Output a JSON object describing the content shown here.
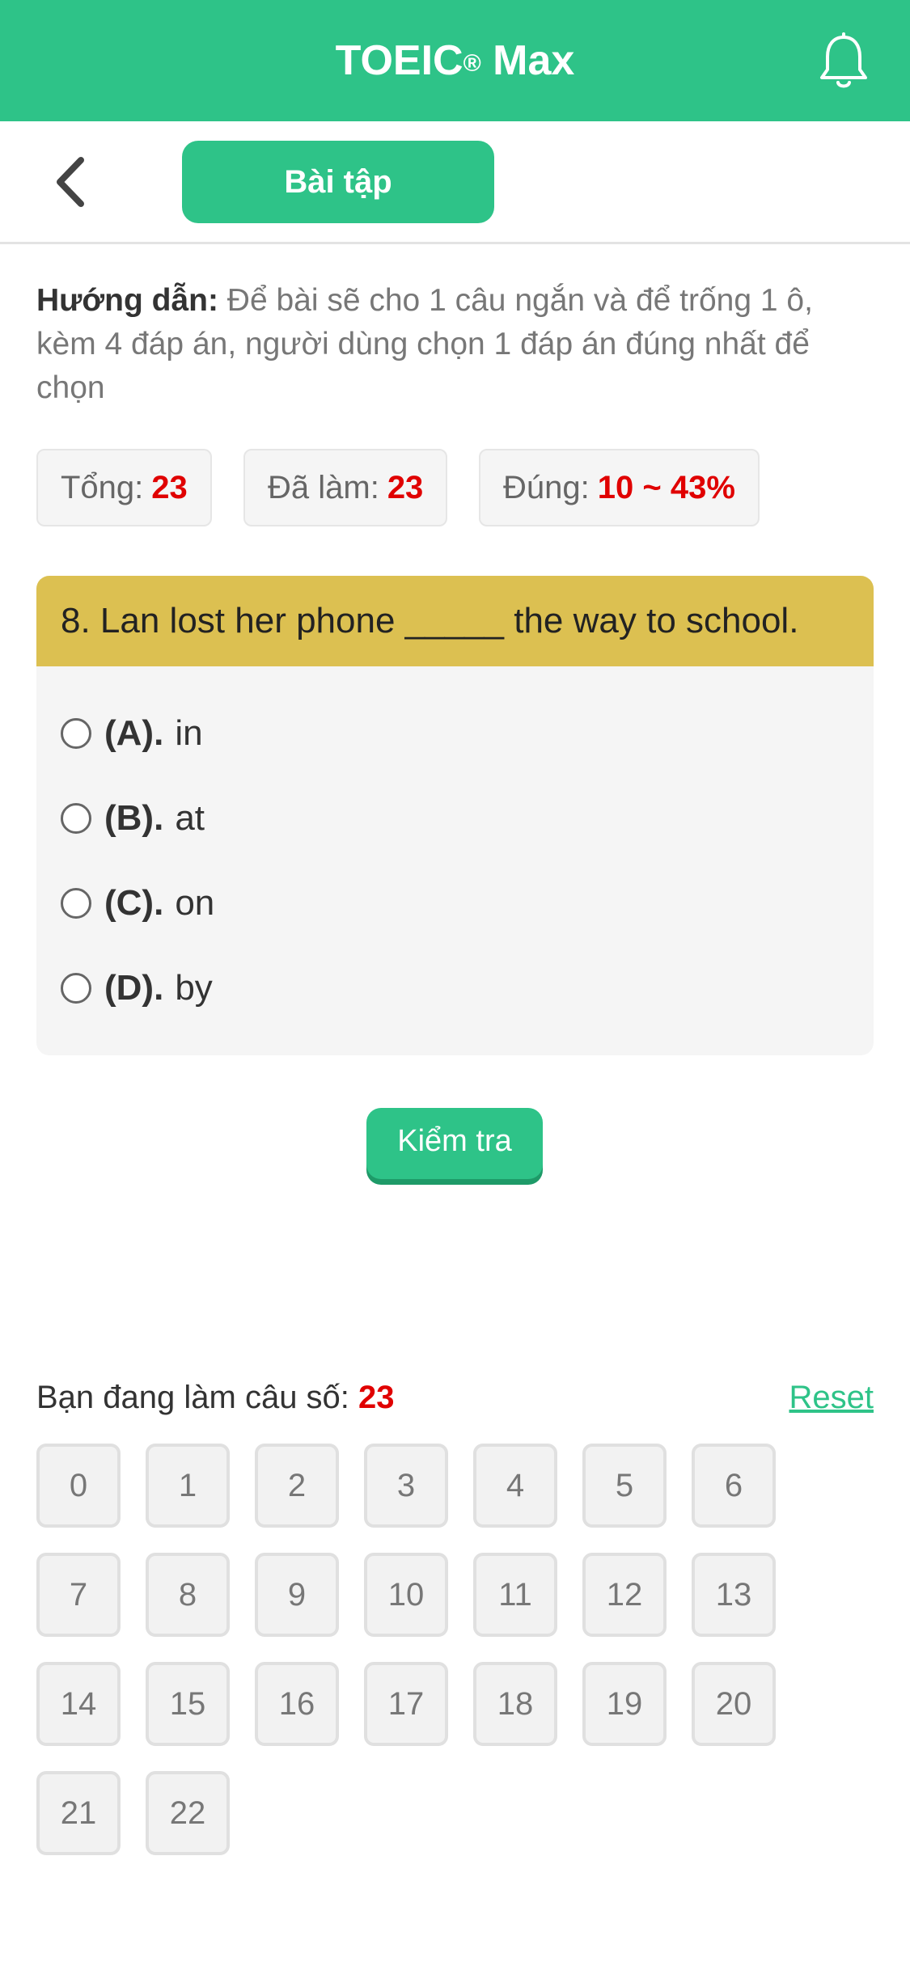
{
  "header": {
    "title_main": "TOEIC",
    "title_reg": "®",
    "title_suffix": " Max",
    "bell_icon": "bell-icon"
  },
  "subheader": {
    "back_icon": "chevron-left-icon",
    "tab_label": "Bài tập"
  },
  "guide": {
    "label": "Hướng dẫn:",
    "text": " Để bài sẽ cho 1 câu ngắn và để trống 1 ô, kèm 4 đáp án, người dùng chọn 1 đáp án đúng nhất để chọn"
  },
  "stats": {
    "total_label": "Tổng:",
    "total_value": "23",
    "done_label": "Đã làm:",
    "done_value": "23",
    "correct_label": "Đúng:",
    "correct_value": "10 ~ 43%"
  },
  "question": {
    "text": "8. Lan lost her phone _____ the way to school.",
    "options": [
      {
        "key": "(A).",
        "text": "in"
      },
      {
        "key": "(B).",
        "text": "at"
      },
      {
        "key": "(C).",
        "text": "on"
      },
      {
        "key": "(D).",
        "text": "by"
      }
    ]
  },
  "check_button": "Kiểm tra",
  "progress": {
    "label": "Bạn đang làm câu số: ",
    "value": "23",
    "reset": "Reset"
  },
  "question_numbers": [
    "0",
    "1",
    "2",
    "3",
    "4",
    "5",
    "6",
    "7",
    "8",
    "9",
    "10",
    "11",
    "12",
    "13",
    "14",
    "15",
    "16",
    "17",
    "18",
    "19",
    "20",
    "21",
    "22"
  ],
  "colors": {
    "primary": "#2ec388",
    "question_header": "#dcc051",
    "highlight": "#e00000"
  }
}
